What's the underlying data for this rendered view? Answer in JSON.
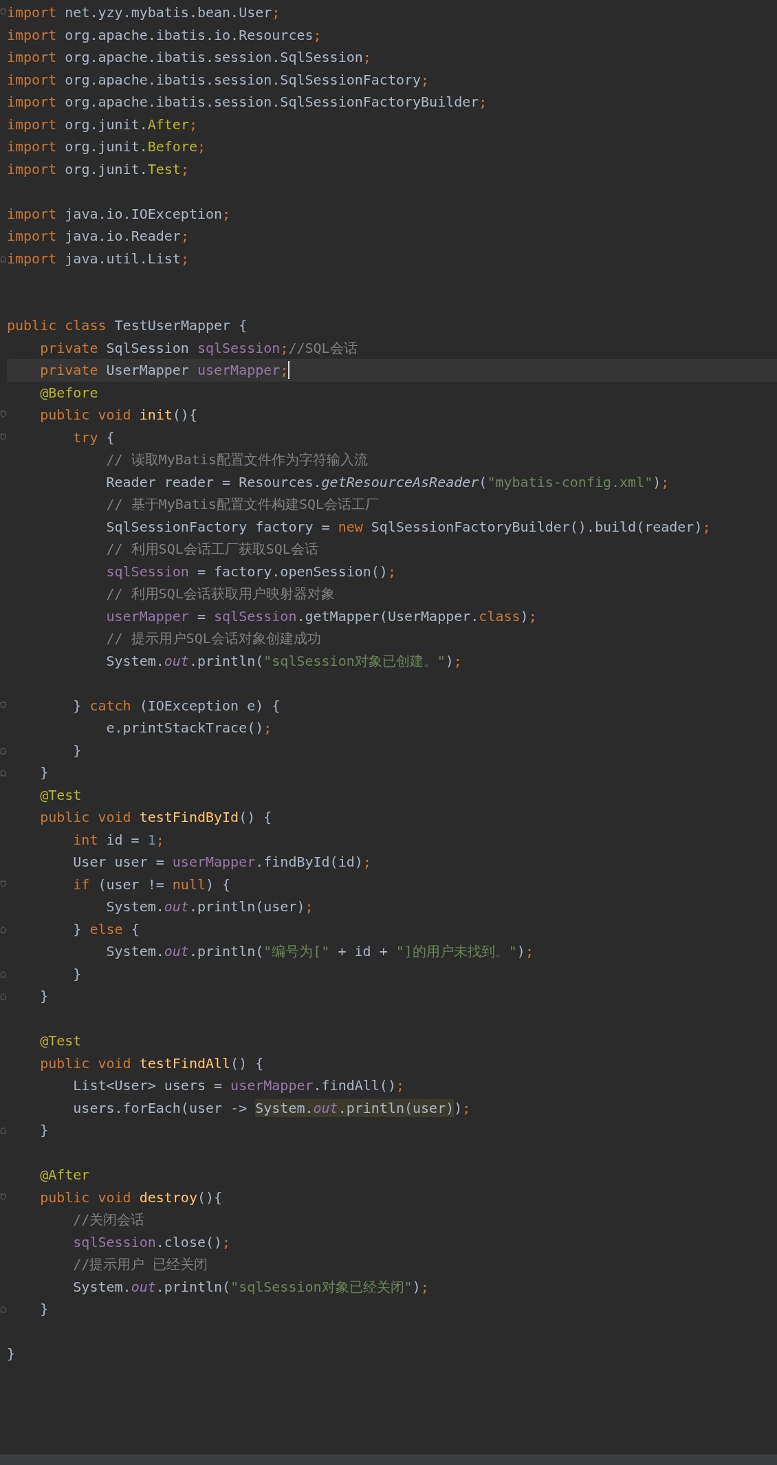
{
  "lines": [
    {
      "kind": "code",
      "marker": {
        "kind": "fold-start"
      },
      "tokens": [
        {
          "kind": "kw",
          "text": "import "
        },
        {
          "kind": "plain",
          "text": "net.yzy.mybatis.bean.User"
        },
        {
          "kind": "kw",
          "text": ";"
        }
      ]
    },
    {
      "kind": "code",
      "tokens": [
        {
          "kind": "kw",
          "text": "import "
        },
        {
          "kind": "plain",
          "text": "org.apache.ibatis.io.Resources"
        },
        {
          "kind": "kw",
          "text": ";"
        }
      ]
    },
    {
      "kind": "code",
      "tokens": [
        {
          "kind": "kw",
          "text": "import "
        },
        {
          "kind": "plain",
          "text": "org.apache.ibatis.session.SqlSession"
        },
        {
          "kind": "kw",
          "text": ";"
        }
      ]
    },
    {
      "kind": "code",
      "tokens": [
        {
          "kind": "kw",
          "text": "import "
        },
        {
          "kind": "plain",
          "text": "org.apache.ibatis.session.SqlSessionFactory"
        },
        {
          "kind": "kw",
          "text": ";"
        }
      ]
    },
    {
      "kind": "code",
      "tokens": [
        {
          "kind": "kw",
          "text": "import "
        },
        {
          "kind": "plain",
          "text": "org.apache.ibatis.session.SqlSessionFactoryBuilder"
        },
        {
          "kind": "kw",
          "text": ";"
        }
      ]
    },
    {
      "kind": "code",
      "tokens": [
        {
          "kind": "kw",
          "text": "import "
        },
        {
          "kind": "plain",
          "text": "org.junit."
        },
        {
          "kind": "ann",
          "text": "After"
        },
        {
          "kind": "kw",
          "text": ";"
        }
      ]
    },
    {
      "kind": "code",
      "tokens": [
        {
          "kind": "kw",
          "text": "import "
        },
        {
          "kind": "plain",
          "text": "org.junit."
        },
        {
          "kind": "ann",
          "text": "Before"
        },
        {
          "kind": "kw",
          "text": ";"
        }
      ]
    },
    {
      "kind": "code",
      "tokens": [
        {
          "kind": "kw",
          "text": "import "
        },
        {
          "kind": "plain",
          "text": "org.junit."
        },
        {
          "kind": "ann",
          "text": "Test"
        },
        {
          "kind": "kw",
          "text": ";"
        }
      ]
    },
    {
      "kind": "blank"
    },
    {
      "kind": "code",
      "tokens": [
        {
          "kind": "kw",
          "text": "import "
        },
        {
          "kind": "plain",
          "text": "java.io.IOException"
        },
        {
          "kind": "kw",
          "text": ";"
        }
      ]
    },
    {
      "kind": "code",
      "tokens": [
        {
          "kind": "kw",
          "text": "import "
        },
        {
          "kind": "plain",
          "text": "java.io.Reader"
        },
        {
          "kind": "kw",
          "text": ";"
        }
      ]
    },
    {
      "kind": "code",
      "marker": {
        "kind": "fold-end"
      },
      "tokens": [
        {
          "kind": "kw",
          "text": "import "
        },
        {
          "kind": "plain",
          "text": "java.util.List"
        },
        {
          "kind": "kw",
          "text": ";"
        }
      ]
    },
    {
      "kind": "blank"
    },
    {
      "kind": "blank"
    },
    {
      "kind": "code",
      "tokens": [
        {
          "kind": "kw",
          "text": "public class "
        },
        {
          "kind": "plain",
          "text": "TestUserMapper {"
        }
      ]
    },
    {
      "kind": "code",
      "tokens": [
        {
          "kind": "kw",
          "text": "    private "
        },
        {
          "kind": "plain",
          "text": "SqlSession "
        },
        {
          "kind": "field",
          "text": "sqlSession"
        },
        {
          "kind": "kw",
          "text": ";"
        },
        {
          "kind": "cmt",
          "text": "//SQL会话"
        }
      ]
    },
    {
      "kind": "code",
      "current": true,
      "tokens": [
        {
          "kind": "kw",
          "text": "    private "
        },
        {
          "kind": "plain",
          "text": "UserMapper "
        },
        {
          "kind": "field",
          "text": "userMapper"
        },
        {
          "kind": "kw",
          "text": ";"
        },
        {
          "kind": "caret"
        }
      ]
    },
    {
      "kind": "code",
      "tokens": [
        {
          "kind": "ann",
          "text": "    @Before"
        }
      ]
    },
    {
      "kind": "code",
      "marker": {
        "kind": "fold-start"
      },
      "tokens": [
        {
          "kind": "kw",
          "text": "    public void "
        },
        {
          "kind": "decl",
          "text": "init"
        },
        {
          "kind": "plain",
          "text": "(){"
        }
      ]
    },
    {
      "kind": "code",
      "marker": {
        "kind": "fold-start"
      },
      "tokens": [
        {
          "kind": "kw",
          "text": "        try "
        },
        {
          "kind": "plain",
          "text": "{"
        }
      ]
    },
    {
      "kind": "code",
      "tokens": [
        {
          "kind": "cmt",
          "text": "            // 读取MyBatis配置文件作为字符输入流"
        }
      ]
    },
    {
      "kind": "code",
      "tokens": [
        {
          "kind": "plain",
          "text": "            Reader reader = Resources."
        },
        {
          "kind": "italic",
          "text": "getResourceAsReader"
        },
        {
          "kind": "plain",
          "text": "("
        },
        {
          "kind": "str",
          "text": "\"mybatis-config.xml\""
        },
        {
          "kind": "plain",
          "text": ")"
        },
        {
          "kind": "kw",
          "text": ";"
        }
      ]
    },
    {
      "kind": "code",
      "tokens": [
        {
          "kind": "cmt",
          "text": "            // 基于MyBatis配置文件构建SQL会话工厂"
        }
      ]
    },
    {
      "kind": "code",
      "tokens": [
        {
          "kind": "plain",
          "text": "            SqlSessionFactory factory = "
        },
        {
          "kind": "kw",
          "text": "new "
        },
        {
          "kind": "plain",
          "text": "SqlSessionFactoryBuilder().build(reader)"
        },
        {
          "kind": "kw",
          "text": ";"
        }
      ]
    },
    {
      "kind": "code",
      "tokens": [
        {
          "kind": "cmt",
          "text": "            // 利用SQL会话工厂获取SQL会话"
        }
      ]
    },
    {
      "kind": "code",
      "tokens": [
        {
          "kind": "field",
          "text": "            sqlSession"
        },
        {
          "kind": "plain",
          "text": " = factory.openSession()"
        },
        {
          "kind": "kw",
          "text": ";"
        }
      ]
    },
    {
      "kind": "code",
      "tokens": [
        {
          "kind": "cmt",
          "text": "            // 利用SQL会话获取用户映射器对象"
        }
      ]
    },
    {
      "kind": "code",
      "tokens": [
        {
          "kind": "field",
          "text": "            userMapper"
        },
        {
          "kind": "plain",
          "text": " = "
        },
        {
          "kind": "field",
          "text": "sqlSession"
        },
        {
          "kind": "plain",
          "text": ".getMapper(UserMapper."
        },
        {
          "kind": "kw",
          "text": "class"
        },
        {
          "kind": "plain",
          "text": ")"
        },
        {
          "kind": "kw",
          "text": ";"
        }
      ]
    },
    {
      "kind": "code",
      "tokens": [
        {
          "kind": "cmt",
          "text": "            // 提示用户SQL会话对象创建成功"
        }
      ]
    },
    {
      "kind": "code",
      "tokens": [
        {
          "kind": "plain",
          "text": "            System."
        },
        {
          "kind": "static",
          "text": "out"
        },
        {
          "kind": "plain",
          "text": ".println("
        },
        {
          "kind": "str",
          "text": "\"sqlSession对象已创建。\""
        },
        {
          "kind": "plain",
          "text": ")"
        },
        {
          "kind": "kw",
          "text": ";"
        }
      ]
    },
    {
      "kind": "blank"
    },
    {
      "kind": "code",
      "marker": {
        "kind": "fold-start"
      },
      "tokens": [
        {
          "kind": "plain",
          "text": "        } "
        },
        {
          "kind": "kw",
          "text": "catch "
        },
        {
          "kind": "plain",
          "text": "(IOException e) {"
        }
      ]
    },
    {
      "kind": "code",
      "tokens": [
        {
          "kind": "plain",
          "text": "            e.printStackTrace()"
        },
        {
          "kind": "kw",
          "text": ";"
        }
      ]
    },
    {
      "kind": "code",
      "marker": {
        "kind": "fold-end"
      },
      "tokens": [
        {
          "kind": "plain",
          "text": "        }"
        }
      ]
    },
    {
      "kind": "code",
      "marker": {
        "kind": "fold-end"
      },
      "tokens": [
        {
          "kind": "plain",
          "text": "    }"
        }
      ]
    },
    {
      "kind": "code",
      "tokens": [
        {
          "kind": "ann",
          "text": "    @Test"
        }
      ]
    },
    {
      "kind": "code",
      "tokens": [
        {
          "kind": "kw",
          "text": "    public void "
        },
        {
          "kind": "decl",
          "text": "testFindById"
        },
        {
          "kind": "plain",
          "text": "() {"
        }
      ]
    },
    {
      "kind": "code",
      "tokens": [
        {
          "kind": "kw",
          "text": "        int "
        },
        {
          "kind": "plain",
          "text": "id = "
        },
        {
          "kind": "num",
          "text": "1"
        },
        {
          "kind": "kw",
          "text": ";"
        }
      ]
    },
    {
      "kind": "code",
      "tokens": [
        {
          "kind": "plain",
          "text": "        User user = "
        },
        {
          "kind": "field",
          "text": "userMapper"
        },
        {
          "kind": "plain",
          "text": ".findById(id)"
        },
        {
          "kind": "kw",
          "text": ";"
        }
      ]
    },
    {
      "kind": "code",
      "marker": {
        "kind": "fold-start"
      },
      "tokens": [
        {
          "kind": "kw",
          "text": "        if "
        },
        {
          "kind": "plain",
          "text": "(user != "
        },
        {
          "kind": "kw",
          "text": "null"
        },
        {
          "kind": "plain",
          "text": ") {"
        }
      ]
    },
    {
      "kind": "code",
      "tokens": [
        {
          "kind": "plain",
          "text": "            System."
        },
        {
          "kind": "static",
          "text": "out"
        },
        {
          "kind": "plain",
          "text": ".println(user)"
        },
        {
          "kind": "kw",
          "text": ";"
        }
      ]
    },
    {
      "kind": "code",
      "marker": {
        "kind": "fold-end"
      },
      "tokens": [
        {
          "kind": "plain",
          "text": "        } "
        },
        {
          "kind": "kw",
          "text": "else "
        },
        {
          "kind": "plain",
          "text": "{"
        }
      ]
    },
    {
      "kind": "code",
      "tokens": [
        {
          "kind": "plain",
          "text": "            System."
        },
        {
          "kind": "static",
          "text": "out"
        },
        {
          "kind": "plain",
          "text": ".println("
        },
        {
          "kind": "str",
          "text": "\"编号为[\""
        },
        {
          "kind": "plain",
          "text": " + id + "
        },
        {
          "kind": "str",
          "text": "\"]的用户未找到。\""
        },
        {
          "kind": "plain",
          "text": ")"
        },
        {
          "kind": "kw",
          "text": ";"
        }
      ]
    },
    {
      "kind": "code",
      "marker": {
        "kind": "fold-end"
      },
      "tokens": [
        {
          "kind": "plain",
          "text": "        }"
        }
      ]
    },
    {
      "kind": "code",
      "marker": {
        "kind": "fold-end"
      },
      "tokens": [
        {
          "kind": "plain",
          "text": "    }"
        }
      ]
    },
    {
      "kind": "blank"
    },
    {
      "kind": "code",
      "tokens": [
        {
          "kind": "ann",
          "text": "    @Test"
        }
      ]
    },
    {
      "kind": "code",
      "tokens": [
        {
          "kind": "kw",
          "text": "    public void "
        },
        {
          "kind": "decl",
          "text": "testFindAll"
        },
        {
          "kind": "plain",
          "text": "() {"
        }
      ]
    },
    {
      "kind": "code",
      "tokens": [
        {
          "kind": "plain",
          "text": "        List<User> users = "
        },
        {
          "kind": "field",
          "text": "userMapper"
        },
        {
          "kind": "plain",
          "text": ".findAll()"
        },
        {
          "kind": "kw",
          "text": ";"
        }
      ]
    },
    {
      "kind": "code",
      "tokens": [
        {
          "kind": "plain",
          "text": "        users.forEach(user -> "
        },
        {
          "kind": "match",
          "parts": [
            {
              "kind": "plain",
              "text": "System."
            },
            {
              "kind": "static",
              "text": "out"
            },
            {
              "kind": "plain",
              "text": ".println(user)"
            }
          ]
        },
        {
          "kind": "plain",
          "text": ")"
        },
        {
          "kind": "kw",
          "text": ";"
        }
      ]
    },
    {
      "kind": "code",
      "marker": {
        "kind": "fold-end"
      },
      "tokens": [
        {
          "kind": "plain",
          "text": "    }"
        }
      ]
    },
    {
      "kind": "blank"
    },
    {
      "kind": "code",
      "tokens": [
        {
          "kind": "ann",
          "text": "    @After"
        }
      ]
    },
    {
      "kind": "code",
      "marker": {
        "kind": "fold-start"
      },
      "tokens": [
        {
          "kind": "kw",
          "text": "    public void "
        },
        {
          "kind": "decl",
          "text": "destroy"
        },
        {
          "kind": "plain",
          "text": "(){"
        }
      ]
    },
    {
      "kind": "code",
      "tokens": [
        {
          "kind": "cmt",
          "text": "        //关闭会话"
        }
      ]
    },
    {
      "kind": "code",
      "tokens": [
        {
          "kind": "field",
          "text": "        sqlSession"
        },
        {
          "kind": "plain",
          "text": ".close()"
        },
        {
          "kind": "kw",
          "text": ";"
        }
      ]
    },
    {
      "kind": "code",
      "tokens": [
        {
          "kind": "cmt",
          "text": "        //提示用户 已经关闭"
        }
      ]
    },
    {
      "kind": "code",
      "tokens": [
        {
          "kind": "plain",
          "text": "        System."
        },
        {
          "kind": "static",
          "text": "out"
        },
        {
          "kind": "plain",
          "text": ".println("
        },
        {
          "kind": "str",
          "text": "\"sqlSession对象已经关闭\""
        },
        {
          "kind": "plain",
          "text": ")"
        },
        {
          "kind": "kw",
          "text": ";"
        }
      ]
    },
    {
      "kind": "code",
      "marker": {
        "kind": "fold-end"
      },
      "tokens": [
        {
          "kind": "plain",
          "text": "    }"
        }
      ]
    },
    {
      "kind": "blank"
    },
    {
      "kind": "code",
      "tokens": [
        {
          "kind": "plain",
          "text": "}"
        }
      ]
    }
  ]
}
